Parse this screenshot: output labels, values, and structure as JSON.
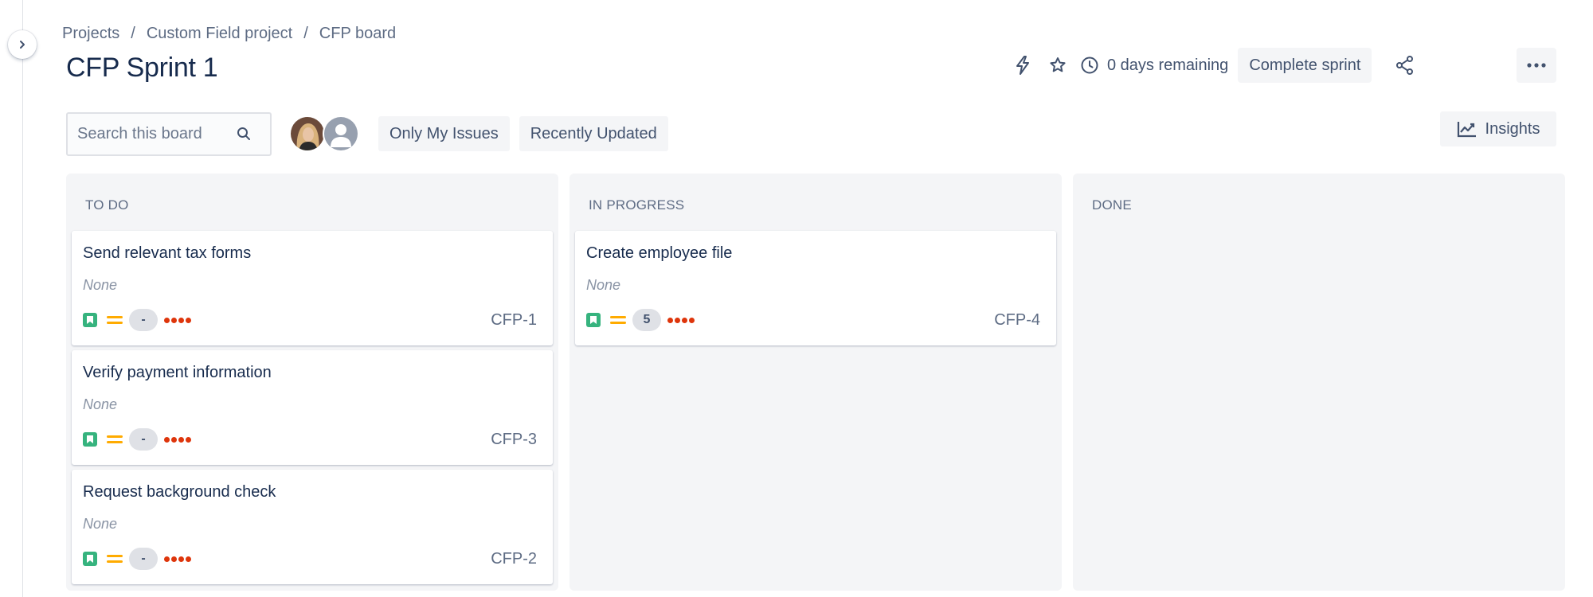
{
  "breadcrumb": {
    "items": [
      "Projects",
      "Custom Field project",
      "CFP board"
    ],
    "separator": "/"
  },
  "sprint": {
    "title": "CFP Sprint 1",
    "days_remaining": "0 days remaining",
    "complete_label": "Complete sprint"
  },
  "toolbar": {
    "search_placeholder": "Search this board",
    "filters": [
      "Only My Issues",
      "Recently Updated"
    ],
    "insights_label": "Insights"
  },
  "icons": {
    "collapse": "chevron-right-icon",
    "automation": "lightning-bolt-icon",
    "star": "star-icon",
    "clock": "clock-icon",
    "share": "share-icon",
    "more": "ellipsis-icon",
    "search": "search-icon",
    "insights": "trend-chart-icon",
    "story": "story-bookmark-icon",
    "priority": "priority-medium-icon"
  },
  "colors": {
    "story": "#36b37e",
    "priority": "#ffab00",
    "dots": "#de350b",
    "column_bg": "#f4f5f7"
  },
  "columns": [
    {
      "title": "TO DO",
      "cards": [
        {
          "title": "Send relevant tax forms",
          "field": "None",
          "estimate": "-",
          "key": "CFP-1"
        },
        {
          "title": "Verify payment information",
          "field": "None",
          "estimate": "-",
          "key": "CFP-3"
        },
        {
          "title": "Request background check",
          "field": "None",
          "estimate": "-",
          "key": "CFP-2"
        }
      ]
    },
    {
      "title": "IN PROGRESS",
      "cards": [
        {
          "title": "Create employee file",
          "field": "None",
          "estimate": "5",
          "key": "CFP-4"
        }
      ]
    },
    {
      "title": "DONE",
      "cards": []
    }
  ]
}
